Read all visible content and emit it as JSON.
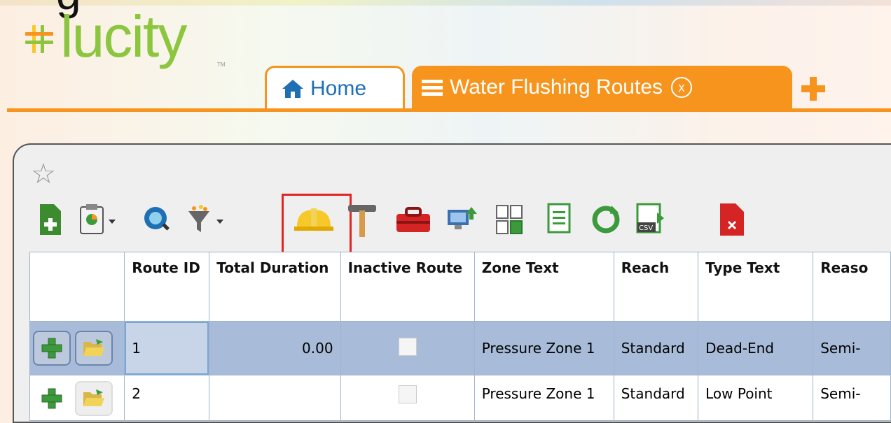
{
  "brand": {
    "name": "lucity",
    "tm": "TM",
    "partial_text": "g"
  },
  "tabs": {
    "home_label": "Home",
    "active_label": "Water Flushing Routes",
    "close_glyph": "x"
  },
  "toolbar": {
    "icons": [
      "add-record-icon",
      "report-icon",
      "map-icon",
      "filter-icon",
      "work-helmet-icon",
      "hammer-icon",
      "toolbox-icon",
      "monitor-upload-icon",
      "copy-icon",
      "document-icon",
      "refresh-icon",
      "csv-export-icon",
      "delete-record-icon"
    ]
  },
  "grid": {
    "columns": [
      "",
      "Route ID",
      "Total Duration",
      "Inactive Route",
      "Zone Text",
      "Reach",
      "Type Text",
      "Reaso"
    ],
    "rows": [
      {
        "route_id": "1",
        "total_duration": "0.00",
        "inactive": false,
        "zone_text": "Pressure Zone 1",
        "reach": "Standard",
        "type_text": "Dead-End",
        "reason": "Semi-"
      },
      {
        "route_id": "2",
        "total_duration": "",
        "inactive": false,
        "zone_text": "Pressure Zone 1",
        "reach": "Standard",
        "type_text": "Low Point",
        "reason": "Semi-"
      }
    ]
  },
  "colors": {
    "accent": "#f7941d",
    "brand_green": "#8cc63f",
    "link_blue": "#1f6fb5",
    "selected_row": "#a8bcd9",
    "highlight": "#e02525"
  }
}
